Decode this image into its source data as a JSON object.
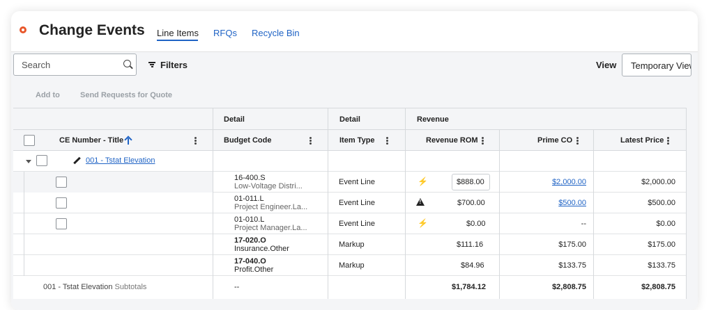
{
  "header": {
    "title": "Change Events",
    "tabs": [
      {
        "label": "Line Items",
        "active": true
      },
      {
        "label": "RFQs",
        "active": false
      },
      {
        "label": "Recycle Bin",
        "active": false
      }
    ]
  },
  "search": {
    "placeholder": "Search"
  },
  "filters_label": "Filters",
  "view": {
    "label": "View",
    "selected": "Temporary View"
  },
  "toolbar": {
    "add_to": "Add to",
    "send_requests": "Send Requests for Quote"
  },
  "table": {
    "group_headers": {
      "detail1": "Detail",
      "detail2": "Detail",
      "revenue": "Revenue"
    },
    "columns": {
      "ce_title": "CE Number - Title",
      "budget_code": "Budget Code",
      "item_type": "Item Type",
      "revenue_rom": "Revenue ROM",
      "prime_co": "Prime CO",
      "latest_price": "Latest Price"
    },
    "group_row": {
      "link": "001 - Tstat Elevation"
    },
    "rows": [
      {
        "code": "16-400.S",
        "code_desc": "Low-Voltage Distri...",
        "item_type": "Event Line",
        "icon": "lightning-icon",
        "rom": "$888.00",
        "prime_co": "$2,000.00",
        "latest": "$2,000.00"
      },
      {
        "code": "01-011.L",
        "code_desc": "Project Engineer.La...",
        "item_type": "Event Line",
        "icon": "warning-icon",
        "rom": "$700.00",
        "prime_co": "$500.00",
        "latest": "$500.00"
      },
      {
        "code": "01-010.L",
        "code_desc": "Project Manager.La...",
        "item_type": "Event Line",
        "icon": "lightning-icon",
        "rom": "$0.00",
        "prime_co": "--",
        "latest": "$0.00"
      },
      {
        "code": "17-020.O",
        "code_desc": "Insurance.Other",
        "item_type": "Markup",
        "rom": "$111.16",
        "prime_co": "$175.00",
        "latest": "$175.00"
      },
      {
        "code": "17-040.O",
        "code_desc": "Profit.Other",
        "item_type": "Markup",
        "rom": "$84.96",
        "prime_co": "$133.75",
        "latest": "$133.75"
      }
    ],
    "subtotal": {
      "name": "001 - Tstat Elevation",
      "suffix": "Subtotals",
      "code": "--",
      "rom": "$1,784.12",
      "prime_co": "$2,808.75",
      "latest": "$2,808.75"
    }
  },
  "colors": {
    "accent": "#1f63c5",
    "brand": "#e8562a"
  }
}
